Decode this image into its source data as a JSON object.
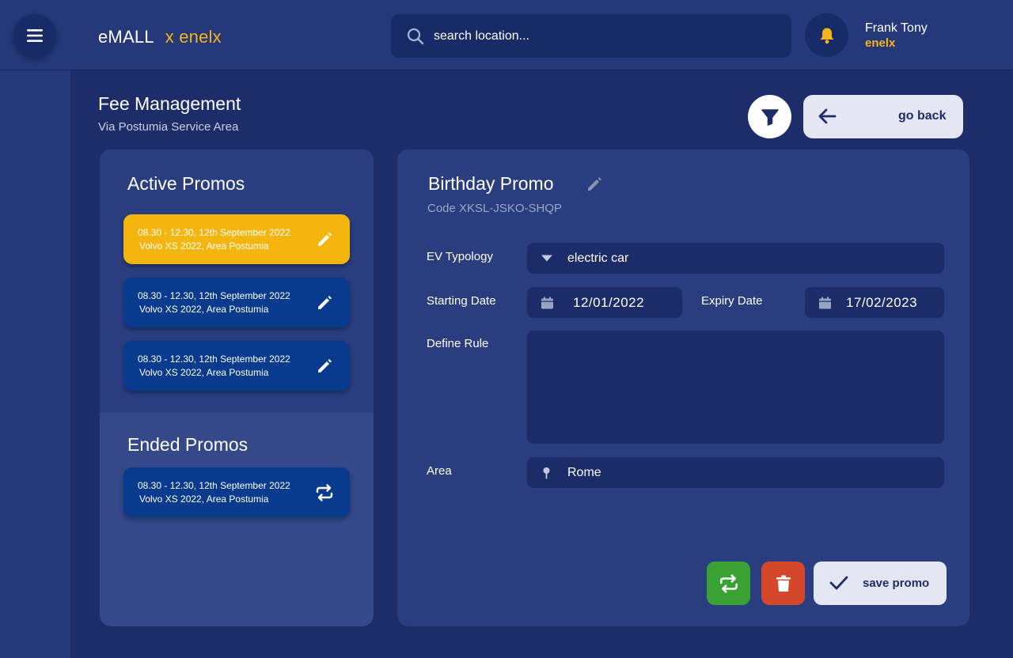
{
  "header": {
    "brand": "eMALL",
    "partner": "x enelx",
    "search_placeholder": "search location...",
    "user": {
      "name": "Frank Tony",
      "org": "enelx"
    }
  },
  "page": {
    "title": "Fee Management",
    "subtitle": "Via Postumia Service Area",
    "back_label": "go back"
  },
  "promos": {
    "active_title": "Active Promos",
    "active": [
      {
        "line1": "08.30 - 12.30, 12th September 2022",
        "line2": "Volvo XS 2022, Area Postumia",
        "action_icon": "pencil-icon",
        "selected": true
      },
      {
        "line1": "08.30 - 12.30, 12th September 2022",
        "line2": "Volvo XS 2022, Area Postumia",
        "action_icon": "pencil-icon",
        "selected": false
      },
      {
        "line1": "08.30 - 12.30, 12th September 2022",
        "line2": "Volvo XS 2022, Area Postumia",
        "action_icon": "pencil-icon",
        "selected": false
      }
    ],
    "ended_title": "Ended Promos",
    "ended": [
      {
        "line1": "08.30 - 12.30, 12th September 2022",
        "line2": "Volvo XS 2022, Area Postumia",
        "action_icon": "repeat-icon"
      }
    ]
  },
  "detail": {
    "name": "Birthday Promo",
    "code": "Code XKSL-JSKO-SHQP",
    "ev_typology_label": "EV Typology",
    "ev_typology_value": "electric car",
    "starting_date_label": "Starting Date",
    "starting_date_value": "12/01/2022",
    "expiry_date_label": "Expiry Date",
    "expiry_date_value": "17/02/2023",
    "define_rule_label": "Define Rule",
    "define_rule_value": "",
    "area_label": "Area",
    "area_value": "Rome",
    "save_label": "save promo"
  },
  "colors": {
    "background": "#1d2d69",
    "accent": "#f5b50f",
    "repeat_button": "#3aa232",
    "delete_button": "#d4472b"
  }
}
